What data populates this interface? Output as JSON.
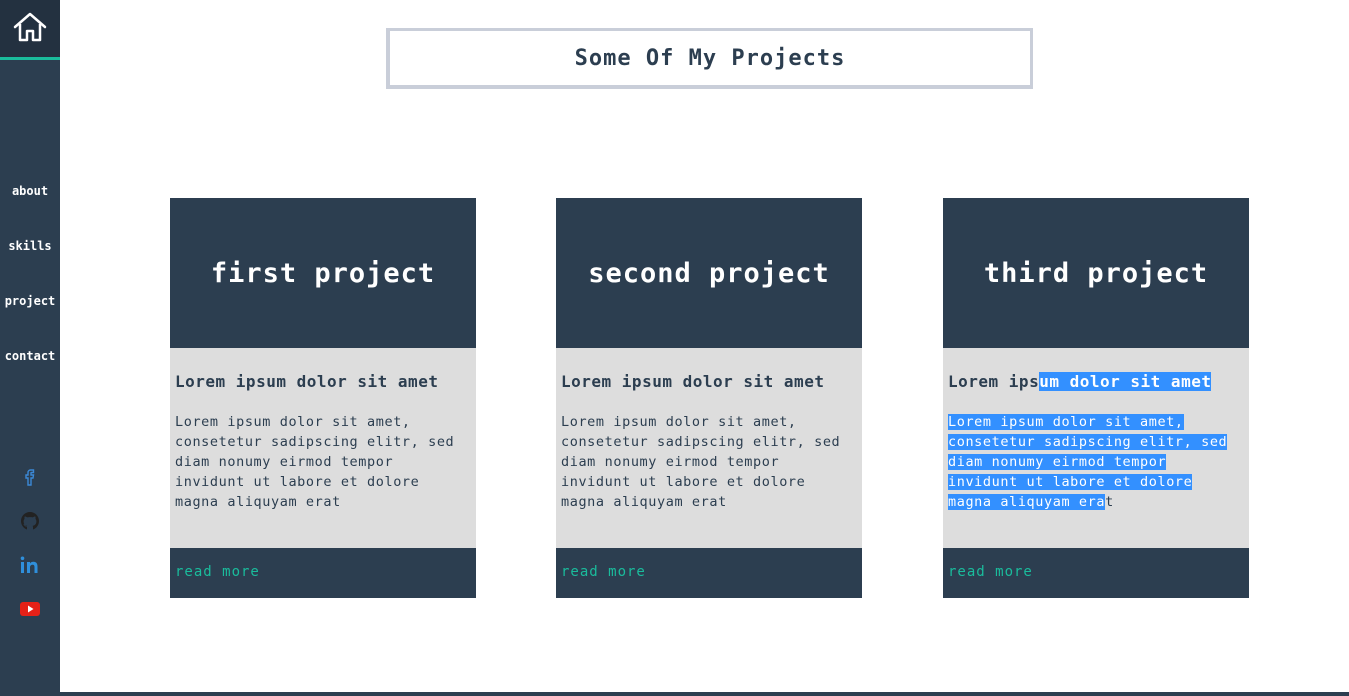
{
  "sidebar": {
    "nav": [
      {
        "label": "about"
      },
      {
        "label": "skills"
      },
      {
        "label": "project"
      },
      {
        "label": "contact"
      }
    ],
    "social": [
      "facebook-icon",
      "github-icon",
      "linkedin-icon",
      "youtube-icon"
    ]
  },
  "main": {
    "title": "Some Of My Projects",
    "cards": [
      {
        "title": "first project",
        "subtitle": "Lorem ipsum dolor sit amet",
        "text": "Lorem ipsum dolor sit amet, consetetur sadipscing elitr, sed diam nonumy eirmod tempor invidunt ut labore et dolore magna aliquyam erat",
        "link": "read more"
      },
      {
        "title": "second project",
        "subtitle": "Lorem ipsum dolor sit amet",
        "text": "Lorem ipsum dolor sit amet, consetetur sadipscing elitr, sed diam nonumy eirmod tempor invidunt ut labore et dolore magna aliquyam erat",
        "link": "read more"
      },
      {
        "title": "third project",
        "subtitle_plain": "Lorem ips",
        "subtitle_selected": "um dolor sit amet",
        "text_selected": "Lorem ipsum dolor sit amet, consetetur sadipscing elitr, sed diam nonumy eirmod tempor invidunt ut labore et dolore magna aliquyam era",
        "text_plain": "t",
        "link": "read more"
      }
    ]
  },
  "colors": {
    "sidebar": "#2c3e50",
    "accent": "#1abc9c",
    "card_body": "#dddddd",
    "selection": "#3390ff"
  }
}
